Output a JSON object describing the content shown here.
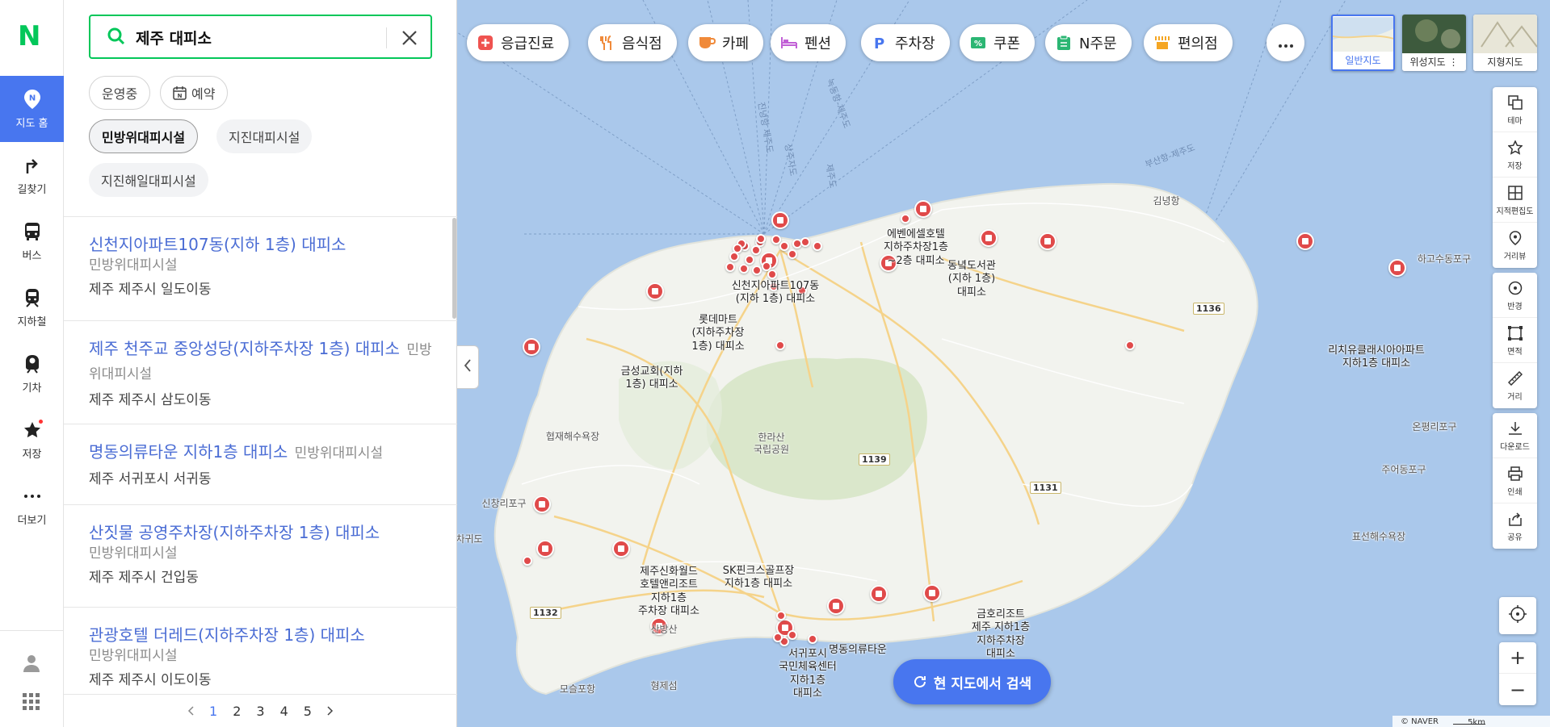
{
  "nav": {
    "logo": "N",
    "items": [
      {
        "label": "지도 홈",
        "icon": "map-pin-icon"
      },
      {
        "label": "길찾기",
        "icon": "directions-icon"
      },
      {
        "label": "버스",
        "icon": "bus-icon"
      },
      {
        "label": "지하철",
        "icon": "subway-icon"
      },
      {
        "label": "기차",
        "icon": "train-icon"
      },
      {
        "label": "저장",
        "icon": "star-icon"
      },
      {
        "label": "더보기",
        "icon": "more-icon"
      }
    ]
  },
  "search": {
    "query": "제주 대피소"
  },
  "filters": {
    "open": "운영중",
    "reserve": "예약",
    "cats": [
      "민방위대피시설",
      "지진대피시설",
      "지진해일대피시설"
    ]
  },
  "results": [
    {
      "name": "신천지아파트107동(지하 1층) 대피소",
      "category": "민방위대피시설",
      "address": "제주 제주시 일도이동"
    },
    {
      "name": "제주 천주교 중앙성당(지하주차장 1층) 대피소",
      "category": "민방위대피시설",
      "address": "제주 제주시 삼도이동"
    },
    {
      "name": "명동의류타운 지하1층 대피소",
      "category": "민방위대피시설",
      "address": "제주 서귀포시 서귀동"
    },
    {
      "name": "산짓물 공영주차장(지하주차장 1층) 대피소",
      "category": "민방위대피시설",
      "address": "제주 제주시 건입동"
    },
    {
      "name": "관광호텔 더레드(지하주차장 1층) 대피소",
      "category": "민방위대피시설",
      "address": "제주 제주시 이도이동"
    }
  ],
  "pager": {
    "pages": [
      "1",
      "2",
      "3",
      "4",
      "5"
    ],
    "current": "1"
  },
  "categories": [
    {
      "label": "응급진료",
      "color": "#ef5350"
    },
    {
      "label": "음식점",
      "color": "#f08a3a"
    },
    {
      "label": "카페",
      "color": "#f08a3a"
    },
    {
      "label": "펜션",
      "color": "#c160d6"
    },
    {
      "label": "주차장",
      "color": "#4876ef"
    },
    {
      "label": "쿠폰",
      "color": "#2bb673"
    },
    {
      "label": "N주문",
      "color": "#2bb673"
    },
    {
      "label": "편의점",
      "color": "#f5a623"
    }
  ],
  "maptypes": [
    "일반지도",
    "위성지도",
    "지형지도"
  ],
  "tools": {
    "g1": [
      "테마",
      "저장",
      "지적편집도",
      "거리뷰"
    ],
    "g2": [
      "반경",
      "면적",
      "거리"
    ],
    "g3": [
      "다운로드",
      "인쇄",
      "공유"
    ]
  },
  "research_label": "현 지도에서 검색",
  "footer": {
    "brand": "© NAVER",
    "scale": "5km"
  },
  "map_labels": {
    "markers": [
      "신천지아파트107동\n(지하 1층) 대피소",
      "에벤에셀호텔\n지하주차장1층\n~2층 대피소",
      "동녘도서관\n(지하 1층)\n대피소",
      "롯데마트\n(지하주차장\n1층) 대피소",
      "금성교회(지하\n1층) 대피소",
      "리치유클래시아아파트\n지하1층 대피소",
      "제주신화월드\n호텔앤리조트\n지하1층\n주차장 대피소",
      "SK핀크스골프장\n지하1층 대피소",
      "서귀포시\n국민체육센터\n지하1층\n대피소",
      "명동의류타운",
      "금호리조트\n제주 지하1층\n지하주차장\n대피소"
    ],
    "places": [
      "김녕항",
      "하고수동포구",
      "온평리포구",
      "주어동포구",
      "표선해수욕장",
      "협재해수욕장",
      "신창리포구",
      "차귀도",
      "모슬포항",
      "형제섬",
      "산방산",
      "한라산\n국립공원"
    ],
    "roads": [
      "1136",
      "1139",
      "1131",
      "1132"
    ],
    "routes": [
      "부산항-제주도",
      "상주자도",
      "제주도",
      "진녕항 제주도",
      "녹동항-제주도"
    ]
  }
}
